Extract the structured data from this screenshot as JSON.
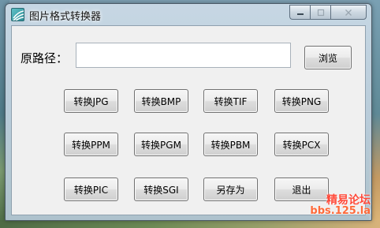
{
  "window": {
    "title": "图片格式转换器",
    "icon": "app-logo-icon"
  },
  "caption": {
    "minimize_icon": "minimize-icon",
    "maximize_icon": "maximize-icon",
    "close_icon": "close-icon"
  },
  "path": {
    "label": "原路径：",
    "value": "",
    "placeholder": ""
  },
  "browse_label": "浏览",
  "buttons": [
    [
      "转换JPG",
      "转换BMP",
      "转换TIF",
      "转换PNG"
    ],
    [
      "转换PPM",
      "转换PGM",
      "转换PBM",
      "转换PCX"
    ],
    [
      "转换PIC",
      "转换SGI",
      "另存为",
      "退出"
    ]
  ],
  "watermark": {
    "line1": "精易论坛",
    "line2": "bbs.125.la"
  },
  "colors": {
    "watermark": "#ff4a3a",
    "client_bg": "#f0f0f0"
  }
}
